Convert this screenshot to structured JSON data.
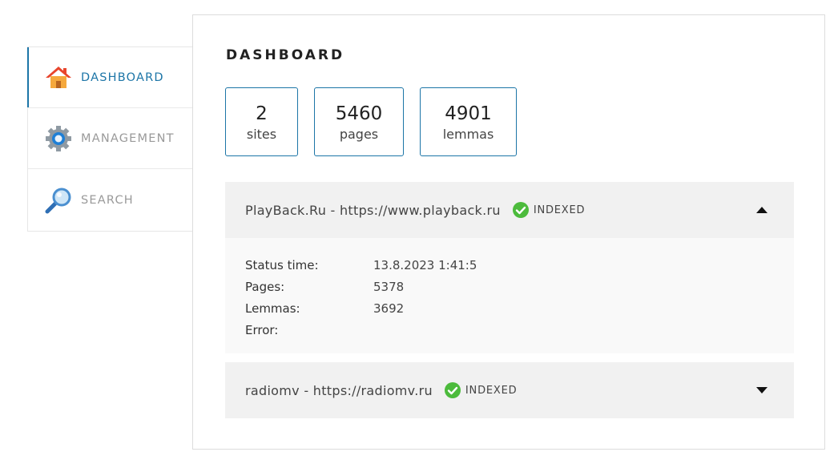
{
  "sidebar": {
    "items": [
      {
        "label": "DASHBOARD",
        "icon": "home-icon",
        "active": true
      },
      {
        "label": "MANAGEMENT",
        "icon": "gear-icon",
        "active": false
      },
      {
        "label": "SEARCH",
        "icon": "magnifier-icon",
        "active": false
      }
    ]
  },
  "main": {
    "title": "DASHBOARD",
    "stats": [
      {
        "value": "2",
        "label": "sites"
      },
      {
        "value": "5460",
        "label": "pages"
      },
      {
        "value": "4901",
        "label": "lemmas"
      }
    ],
    "sites": [
      {
        "title": "PlayBack.Ru - https://www.playback.ru",
        "status": "INDEXED",
        "expanded": true,
        "details": [
          {
            "label": "Status time:",
            "value": "13.8.2023 1:41:5"
          },
          {
            "label": "Pages:",
            "value": "5378"
          },
          {
            "label": "Lemmas:",
            "value": "3692"
          },
          {
            "label": "Error:",
            "value": ""
          }
        ]
      },
      {
        "title": "radiomv - https://radiomv.ru",
        "status": "INDEXED",
        "expanded": false
      }
    ]
  },
  "colors": {
    "accent": "#1c75a7",
    "success": "#4cbb3c",
    "panel_bg": "#f1f1f1",
    "detail_bg": "#f9f9f9"
  }
}
